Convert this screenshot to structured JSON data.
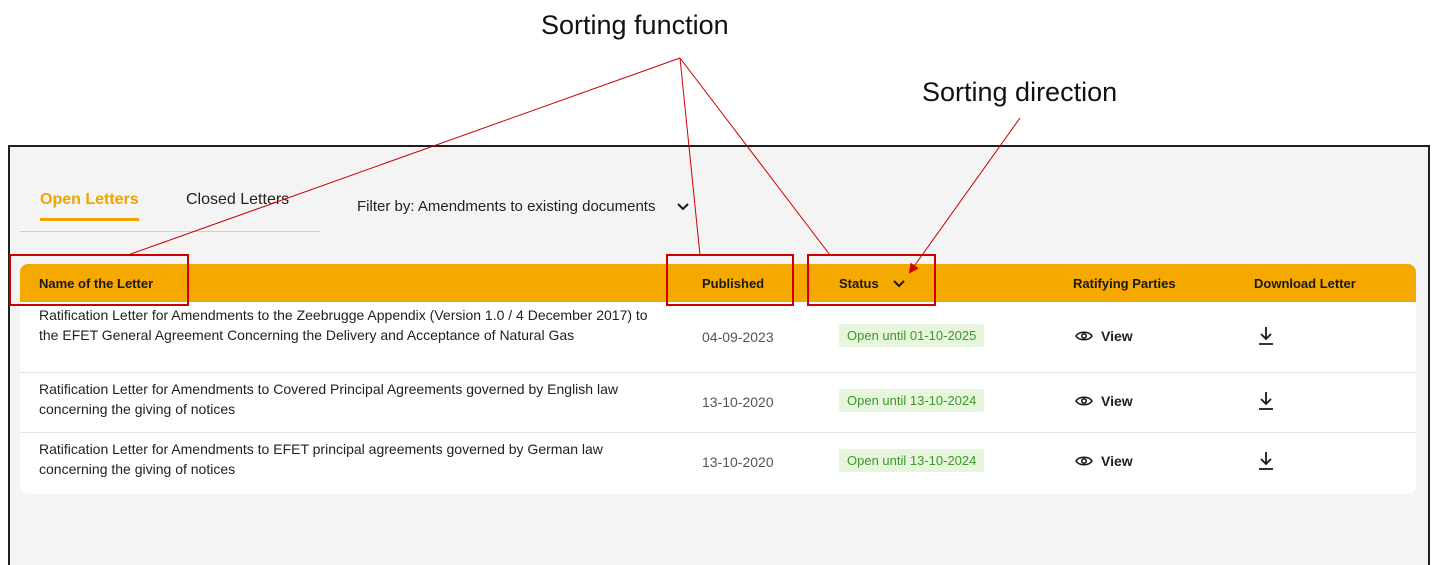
{
  "annotations": {
    "sorting_function": "Sorting function",
    "sorting_direction": "Sorting direction"
  },
  "tabs": [
    {
      "label": "Open Letters",
      "active": true
    },
    {
      "label": "Closed Letters",
      "active": false
    }
  ],
  "filter": {
    "label": "Filter by: Amendments to existing documents"
  },
  "table": {
    "headers": {
      "name": "Name of the Letter",
      "published": "Published",
      "status": "Status",
      "ratifying": "Ratifying Parties",
      "download": "Download Letter"
    },
    "rows": [
      {
        "name": "Ratification Letter for Amendments to the Zeebrugge Appendix (Version 1.0 / 4 December 2017) to the EFET General Agreement Concerning the Delivery and Acceptance of Natural Gas",
        "published": "04-09-2023",
        "status": "Open until 01-10-2025",
        "view": "View"
      },
      {
        "name": "Ratification Letter for Amendments to Covered Principal Agreements governed by English law concerning the giving of notices",
        "published": "13-10-2020",
        "status": "Open until 13-10-2024",
        "view": "View"
      },
      {
        "name": "Ratification Letter for Amendments to EFET principal agreements governed by German law concerning the giving of notices",
        "published": "13-10-2020",
        "status": "Open until 13-10-2024",
        "view": "View"
      }
    ]
  },
  "colors": {
    "accent": "#f5a800",
    "status_text": "#3a9a2a",
    "status_bg": "#e6f5dc",
    "annotation": "#cc0000"
  },
  "icons": [
    "chevron-down-icon",
    "eye-icon",
    "download-icon",
    "arrow-icon"
  ]
}
